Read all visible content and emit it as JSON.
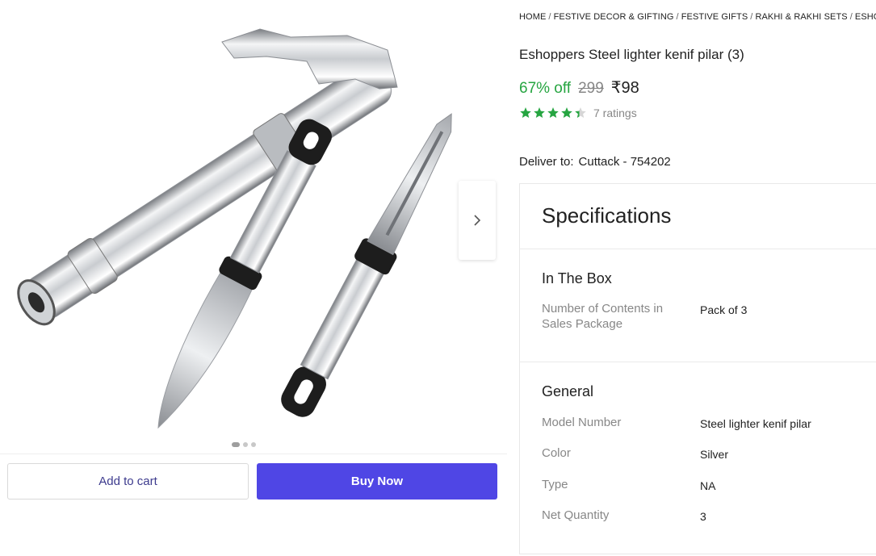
{
  "gallery": {
    "image_alt": "Steel gas lighter, knife and peeler",
    "next_icon": "chevron-right-icon",
    "dots": [
      true,
      false,
      false
    ]
  },
  "actions": {
    "add_to_cart": "Add to cart",
    "buy_now": "Buy Now"
  },
  "breadcrumb": [
    "HOME",
    "FESTIVE DECOR & GIFTING",
    "FESTIVE GIFTS",
    "RAKHI & RAKHI SETS",
    "ESHOPPERS"
  ],
  "product": {
    "title": "Eshoppers Steel lighter kenif pilar (3)",
    "discount": "67% off",
    "mrp": "299",
    "price": "₹98",
    "rating_value": 4.4,
    "ratings_count": "7 ratings"
  },
  "delivery": {
    "label": "Deliver to:",
    "location": "Cuttack - 754202"
  },
  "specifications": {
    "heading": "Specifications",
    "sections": [
      {
        "title": "In The Box",
        "rows": [
          {
            "key": "Number of Contents in Sales Package",
            "value": "Pack of 3"
          }
        ]
      },
      {
        "title": "General",
        "rows": [
          {
            "key": "Model Number",
            "value": "Steel lighter kenif pilar"
          },
          {
            "key": "Color",
            "value": "Silver"
          },
          {
            "key": "Type",
            "value": "NA"
          },
          {
            "key": "Net Quantity",
            "value": "3"
          }
        ]
      }
    ]
  },
  "colors": {
    "accent": "#4f46e5",
    "discount": "#26a541",
    "star": "#26a541"
  }
}
